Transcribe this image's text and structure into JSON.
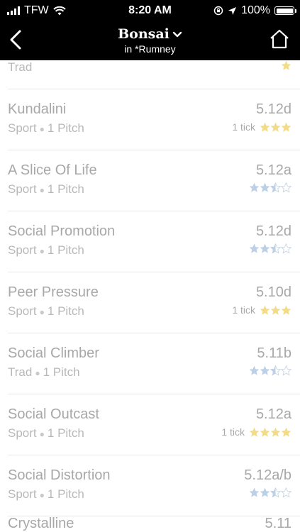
{
  "status": {
    "carrier": "TFW",
    "time": "8:20 AM",
    "battery": "100%"
  },
  "nav": {
    "title": "Bonsai",
    "subtitle": "in *Rumney"
  },
  "colors": {
    "gold_star": "#f2dc8a",
    "blue_star": "#bcd0e6",
    "empty_star": "#c9d4e0"
  },
  "top_partial": {
    "meta": "Trad",
    "stars": {
      "color": "gold",
      "filled": 1,
      "half": false,
      "empty": 0
    }
  },
  "routes": [
    {
      "name": "Kundalini",
      "type": "Sport",
      "pitches": "1 Pitch",
      "grade": "5.12d",
      "ticks": "1 tick",
      "stars": {
        "color": "gold",
        "filled": 3,
        "half": false,
        "empty": 0
      }
    },
    {
      "name": "A Slice Of Life",
      "type": "Sport",
      "pitches": "1 Pitch",
      "grade": "5.12a",
      "ticks": "",
      "stars": {
        "color": "blue",
        "filled": 2,
        "half": true,
        "empty": 1
      }
    },
    {
      "name": "Social Promotion",
      "type": "Sport",
      "pitches": "1 Pitch",
      "grade": "5.12d",
      "ticks": "",
      "stars": {
        "color": "blue",
        "filled": 2,
        "half": true,
        "empty": 1
      }
    },
    {
      "name": "Peer Pressure",
      "type": "Sport",
      "pitches": "1 Pitch",
      "grade": "5.10d",
      "ticks": "1 tick",
      "stars": {
        "color": "gold",
        "filled": 3,
        "half": false,
        "empty": 0
      }
    },
    {
      "name": "Social Climber",
      "type": "Trad",
      "pitches": "1 Pitch",
      "grade": "5.11b",
      "ticks": "",
      "stars": {
        "color": "blue",
        "filled": 2,
        "half": true,
        "empty": 1
      }
    },
    {
      "name": "Social Outcast",
      "type": "Sport",
      "pitches": "1 Pitch",
      "grade": "5.12a",
      "ticks": "1 tick",
      "stars": {
        "color": "gold",
        "filled": 4,
        "half": false,
        "empty": 0
      }
    },
    {
      "name": "Social Distortion",
      "type": "Sport",
      "pitches": "1 Pitch",
      "grade": "5.12a/b",
      "ticks": "",
      "stars": {
        "color": "blue",
        "filled": 2,
        "half": true,
        "empty": 1
      }
    }
  ],
  "last_partial": {
    "name": "Crystalline",
    "grade": "5.11"
  }
}
